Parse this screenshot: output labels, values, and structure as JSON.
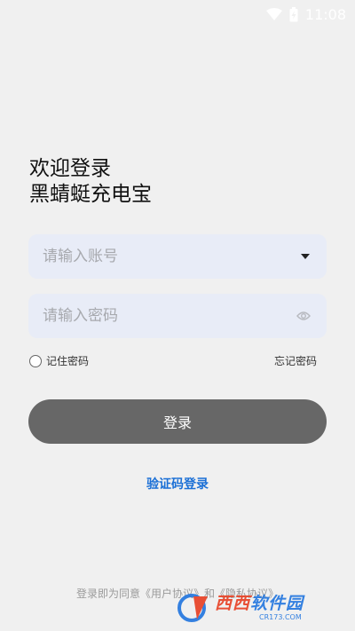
{
  "status_bar": {
    "time": "11:08",
    "wifi_icon": "wifi-icon",
    "battery_icon": "battery-charging-icon"
  },
  "header": {
    "welcome": "欢迎登录",
    "app_name": "黑蜻蜓充电宝"
  },
  "account": {
    "placeholder": "请输入账号",
    "value": "",
    "dropdown_icon": "caret-down-icon"
  },
  "password": {
    "placeholder": "请输入密码",
    "value": "",
    "toggle_icon": "eye-icon"
  },
  "options": {
    "remember_label": "记住密码",
    "remember_checked": false,
    "forgot_label": "忘记密码"
  },
  "login_button": {
    "label": "登录"
  },
  "code_login": {
    "label": "验证码登录"
  },
  "agreement": {
    "prefix": "登录即为同意",
    "user_agreement": "《用户协议》",
    "and": "和",
    "privacy": "《隐私协议》"
  },
  "watermark": {
    "main_red": "西西",
    "main_blue": "软件园",
    "sub": "CR173.COM"
  },
  "colors": {
    "background": "#f0f0f0",
    "field_bg": "#e8ecf7",
    "button_bg": "#676767",
    "link": "#1a6fd6"
  }
}
